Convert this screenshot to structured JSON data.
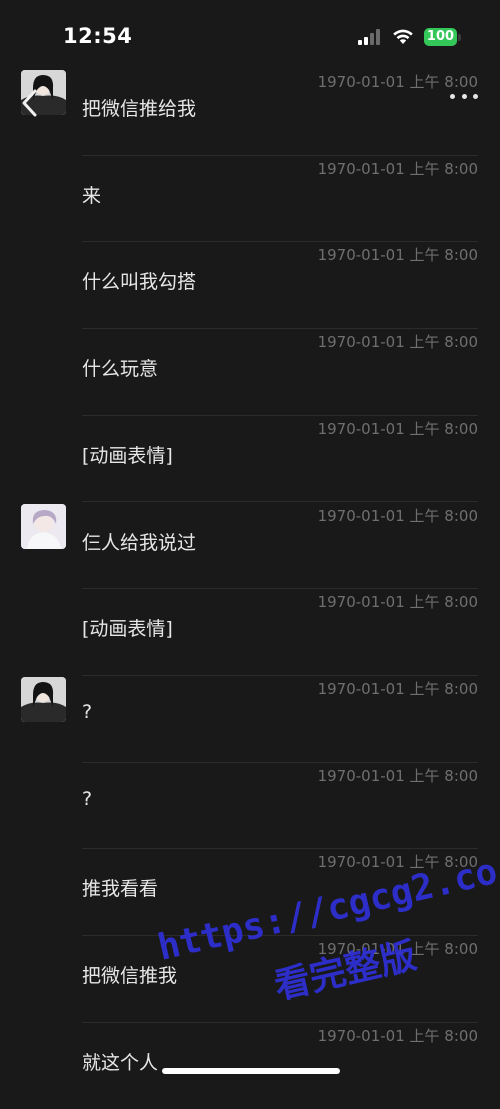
{
  "status_bar": {
    "time": "12:54",
    "battery": "100",
    "accent_color": "#34c759"
  },
  "nav": {
    "back_icon": "chevron-left-icon",
    "more_icon": "ellipsis-icon"
  },
  "messages": [
    {
      "time": "1970-01-01 上午 8:00",
      "text": "把微信推给我",
      "avatar": "dark"
    },
    {
      "time": "1970-01-01 上午 8:00",
      "text": "来",
      "avatar": ""
    },
    {
      "time": "1970-01-01 上午 8:00",
      "text": "什么叫我勾搭",
      "avatar": ""
    },
    {
      "time": "1970-01-01 上午 8:00",
      "text": "什么玩意",
      "avatar": ""
    },
    {
      "time": "1970-01-01 上午 8:00",
      "text": "[动画表情]",
      "avatar": ""
    },
    {
      "time": "1970-01-01 上午 8:00",
      "text": "仨人给我说过",
      "avatar": "light"
    },
    {
      "time": "1970-01-01 上午 8:00",
      "text": "[动画表情]",
      "avatar": ""
    },
    {
      "time": "1970-01-01 上午 8:00",
      "text": "?",
      "avatar": "dark"
    },
    {
      "time": "1970-01-01 上午 8:00",
      "text": "?",
      "avatar": ""
    },
    {
      "time": "1970-01-01 上午 8:00",
      "text": "推我看看",
      "avatar": ""
    },
    {
      "time": "1970-01-01 上午 8:00",
      "text": "把微信推我",
      "avatar": ""
    },
    {
      "time": "1970-01-01 上午 8:00",
      "text": "就这个人",
      "avatar": ""
    }
  ],
  "watermark": {
    "url": "https://cgcg2.co",
    "text": "看完整版",
    "color": "#2f2fd6"
  }
}
